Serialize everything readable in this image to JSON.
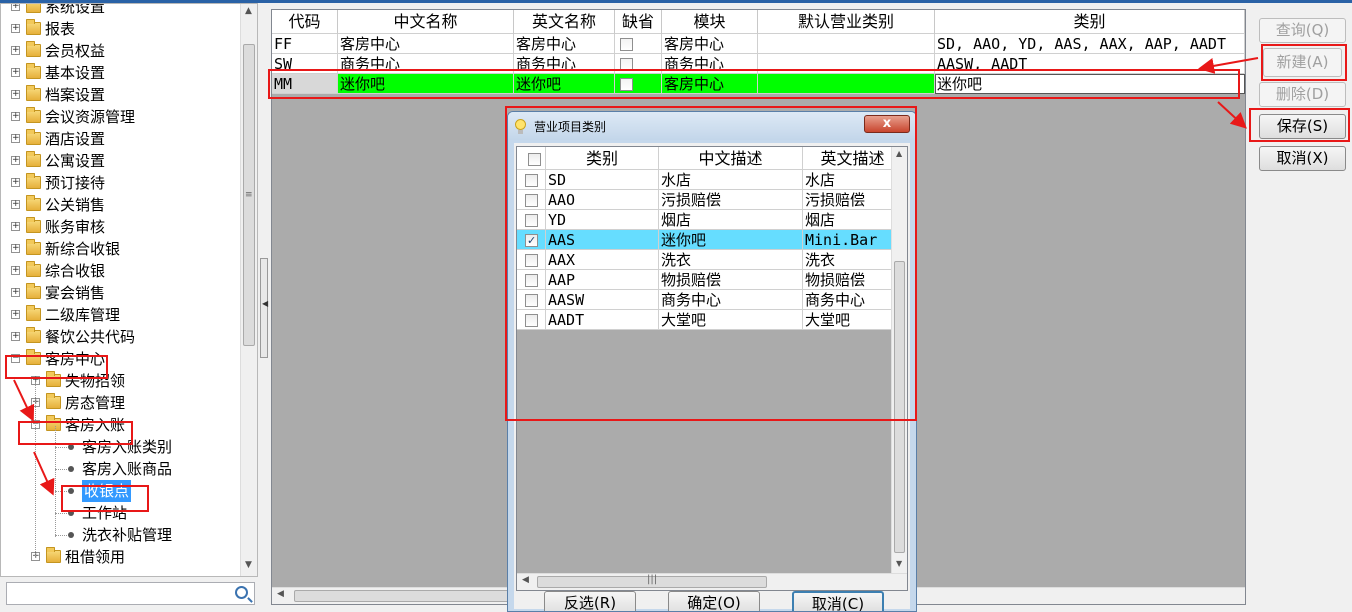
{
  "tree": {
    "items": [
      {
        "label": "系统设置",
        "level": 0,
        "kind": "folder",
        "expander": "+"
      },
      {
        "label": "报表",
        "level": 0,
        "kind": "folder",
        "expander": "+"
      },
      {
        "label": "会员权益",
        "level": 0,
        "kind": "folder",
        "expander": "+"
      },
      {
        "label": "基本设置",
        "level": 0,
        "kind": "folder",
        "expander": "+"
      },
      {
        "label": "档案设置",
        "level": 0,
        "kind": "folder",
        "expander": "+"
      },
      {
        "label": "会议资源管理",
        "level": 0,
        "kind": "folder",
        "expander": "+"
      },
      {
        "label": "酒店设置",
        "level": 0,
        "kind": "folder",
        "expander": "+"
      },
      {
        "label": "公寓设置",
        "level": 0,
        "kind": "folder",
        "expander": "+"
      },
      {
        "label": "预订接待",
        "level": 0,
        "kind": "folder",
        "expander": "+"
      },
      {
        "label": "公关销售",
        "level": 0,
        "kind": "folder",
        "expander": "+"
      },
      {
        "label": "账务审核",
        "level": 0,
        "kind": "folder",
        "expander": "+"
      },
      {
        "label": "新综合收银",
        "level": 0,
        "kind": "folder",
        "expander": "+"
      },
      {
        "label": "综合收银",
        "level": 0,
        "kind": "folder",
        "expander": "+"
      },
      {
        "label": "宴会销售",
        "level": 0,
        "kind": "folder",
        "expander": "+"
      },
      {
        "label": "二级库管理",
        "level": 0,
        "kind": "folder",
        "expander": "+"
      },
      {
        "label": "餐饮公共代码",
        "level": 0,
        "kind": "folder",
        "expander": "+"
      },
      {
        "label": "客房中心",
        "level": 0,
        "kind": "folder",
        "expander": "−"
      },
      {
        "label": "失物招领",
        "level": 1,
        "kind": "folder",
        "expander": "+"
      },
      {
        "label": "房态管理",
        "level": 1,
        "kind": "folder",
        "expander": "+"
      },
      {
        "label": "客房入账",
        "level": 1,
        "kind": "folder",
        "expander": "−"
      },
      {
        "label": "客房入账类别",
        "level": 2,
        "kind": "leaf"
      },
      {
        "label": "客房入账商品",
        "level": 2,
        "kind": "leaf"
      },
      {
        "label": "收银点",
        "level": 2,
        "kind": "leaf",
        "selected": true
      },
      {
        "label": "工作站",
        "level": 2,
        "kind": "leaf"
      },
      {
        "label": "洗衣补贴管理",
        "level": 2,
        "kind": "leaf"
      },
      {
        "label": "租借领用",
        "level": 1,
        "kind": "folder",
        "expander": "+"
      }
    ]
  },
  "grid": {
    "columns": [
      "代码",
      "中文名称",
      "英文名称",
      "缺省",
      "模块",
      "默认营业类别",
      "类别"
    ],
    "rows": [
      {
        "code": "FF",
        "cn": "客房中心",
        "en": "客房中心",
        "module": "客房中心",
        "default_cat": "",
        "cats": "SD, AAO, YD, AAS, AAX, AAP, AADT",
        "highlight": false
      },
      {
        "code": "SW",
        "cn": "商务中心",
        "en": "商务中心",
        "module": "商务中心",
        "default_cat": "",
        "cats": "AASW, AADT",
        "highlight": false
      },
      {
        "code": "MM",
        "cn": "迷你吧",
        "en": "迷你吧",
        "module": "客房中心",
        "default_cat": "",
        "cats": "迷你吧",
        "highlight": true
      }
    ]
  },
  "buttons": {
    "query": "查询(Q)",
    "new": "新建(A)",
    "delete": "删除(D)",
    "save": "保存(S)",
    "cancel": "取消(X)"
  },
  "dialog": {
    "title": "营业项目类别",
    "close": "x",
    "columns": [
      "类别",
      "中文描述",
      "英文描述"
    ],
    "rows": [
      {
        "code": "SD",
        "cn": "水店",
        "en": "水店",
        "checked": false
      },
      {
        "code": "AAO",
        "cn": "污损赔偿",
        "en": "污损赔偿",
        "checked": false
      },
      {
        "code": "YD",
        "cn": "烟店",
        "en": "烟店",
        "checked": false
      },
      {
        "code": "AAS",
        "cn": "迷你吧",
        "en": "Mini.Bar",
        "checked": true
      },
      {
        "code": "AAX",
        "cn": "洗衣",
        "en": "洗衣",
        "checked": false
      },
      {
        "code": "AAP",
        "cn": "物损赔偿",
        "en": "物损赔偿",
        "checked": false
      },
      {
        "code": "AASW",
        "cn": "商务中心",
        "en": "商务中心",
        "checked": false
      },
      {
        "code": "AADT",
        "cn": "大堂吧",
        "en": "大堂吧",
        "checked": false
      }
    ],
    "buttons": {
      "invert": "反选(R)",
      "ok": "确定(O)",
      "cancel": "取消(C)"
    }
  },
  "colors": {
    "highlight_row": "#00ff00",
    "dialog_selected": "#66ddff",
    "tree_selected": "#3399ff",
    "annotation": "#e81818"
  }
}
